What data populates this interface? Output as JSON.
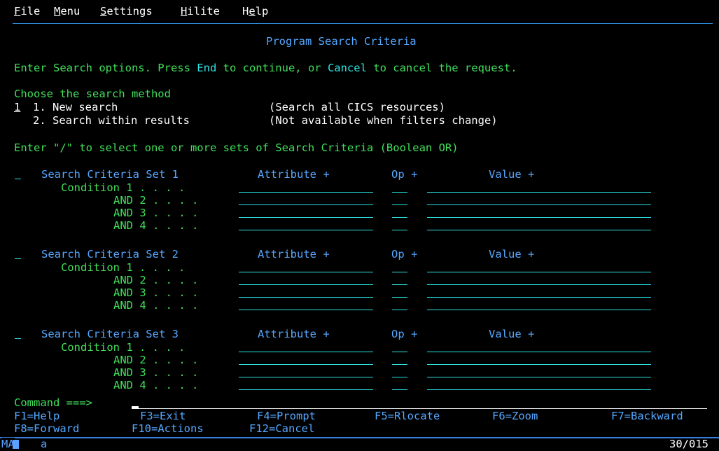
{
  "menubar": {
    "items": [
      {
        "key": "F",
        "rest": "ile"
      },
      {
        "key": "M",
        "rest": "enu"
      },
      {
        "key": "S",
        "rest": "ettings"
      },
      {
        "key": "H",
        "rest": "ilite"
      },
      {
        "key": "He",
        "rest": "lp",
        "underline_index": 1
      }
    ]
  },
  "panel": {
    "title": "Program Search Criteria",
    "instruction_pre": "Enter Search options. Press ",
    "instruction_end": "End",
    "instruction_mid": " to continue, or ",
    "instruction_cancel": "Cancel",
    "instruction_post": " to cancel the request."
  },
  "method": {
    "heading": "Choose the search method",
    "selected_value": "1",
    "options": [
      {
        "label": "1. New search",
        "note": "(Search all CICS resources)"
      },
      {
        "label": "2. Search within results",
        "note": "(Not available when filters change)"
      }
    ]
  },
  "criteria_prompt": "Enter \"/\" to select one or more sets of Search Criteria (Boolean OR)",
  "sets": [
    {
      "title": "Search Criteria Set 1",
      "attr": "Attribute +",
      "op": "Op +",
      "value": "Value +",
      "conds": [
        "Condition 1 . . . .",
        "AND 2 . . . .",
        "AND 3 . . . .",
        "AND 4 . . . ."
      ]
    },
    {
      "title": "Search Criteria Set 2",
      "attr": "Attribute +",
      "op": "Op +",
      "value": "Value +",
      "conds": [
        "Condition 1 . . . .",
        "AND 2 . . . .",
        "AND 3 . . . .",
        "AND 4 . . . ."
      ]
    },
    {
      "title": "Search Criteria Set 3",
      "attr": "Attribute +",
      "op": "Op +",
      "value": "Value +",
      "conds": [
        "Condition 1 . . . .",
        "AND 2 . . . .",
        "AND 3 . . . .",
        "AND 4 . . . ."
      ]
    }
  ],
  "command": {
    "label": "Command ===>"
  },
  "fkeys_row1": [
    "F1=Help",
    "F3=Exit",
    "F4=Prompt",
    "F5=Rlocate",
    "F6=Zoom",
    "F7=Backward"
  ],
  "fkeys_row2": [
    "F8=Forward",
    "F10=Actions",
    "F12=Cancel"
  ],
  "status": {
    "left": "MA",
    "mid": "a",
    "right": "30/015"
  },
  "colors": {
    "background": "#000000",
    "white": "#ffffff",
    "turquoise": "#2ee4e4",
    "green": "#41e05a",
    "blue": "#55a8ff"
  }
}
